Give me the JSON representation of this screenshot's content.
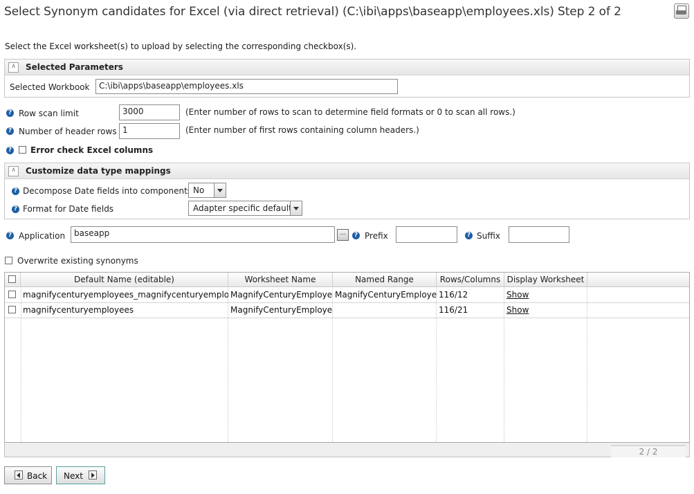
{
  "page": {
    "title": "Select Synonym candidates for Excel (via direct retrieval) (C:\\ibi\\apps\\baseapp\\employees.xls) Step 2 of 2",
    "instructions": "Select the Excel worksheet(s) to upload by selecting the corresponding checkbox(s)."
  },
  "selected_parameters": {
    "title": "Selected Parameters",
    "workbook_label": "Selected Workbook",
    "workbook_value": "C:\\ibi\\apps\\baseapp\\employees.xls"
  },
  "options": {
    "row_scan_label": "Row scan limit",
    "row_scan_value": "3000",
    "row_scan_hint": "(Enter number of rows to scan to determine field formats or 0 to scan all rows.)",
    "header_rows_label": "Number of header rows",
    "header_rows_value": "1",
    "header_rows_hint": "(Enter number of first rows containing column headers.)",
    "error_check_label": "Error check Excel columns"
  },
  "customize": {
    "title": "Customize data type mappings",
    "decompose_label": "Decompose Date fields into components",
    "decompose_value": "No",
    "format_label": "Format for Date fields",
    "format_value": "Adapter specific default"
  },
  "application": {
    "label": "Application",
    "value": "baseapp",
    "browse": "...",
    "prefix_label": "Prefix",
    "prefix_value": "",
    "suffix_label": "Suffix",
    "suffix_value": ""
  },
  "overwrite_label": "Overwrite existing synonyms",
  "grid": {
    "headers": [
      "Default Name (editable)",
      "Worksheet Name",
      "Named Range",
      "Rows/Columns",
      "Display Worksheet"
    ],
    "rows": [
      {
        "name": "magnifycenturyemployees_magnifycenturyemployees",
        "worksheet": "MagnifyCenturyEmployees",
        "range": "MagnifyCenturyEmployees",
        "rowscols": "116/12",
        "display": "Show"
      },
      {
        "name": "magnifycenturyemployees",
        "worksheet": "MagnifyCenturyEmployees",
        "range": "",
        "rowscols": "116/21",
        "display": "Show"
      }
    ],
    "pager": "2 / 2"
  },
  "buttons": {
    "back": "Back",
    "next": "Next"
  }
}
